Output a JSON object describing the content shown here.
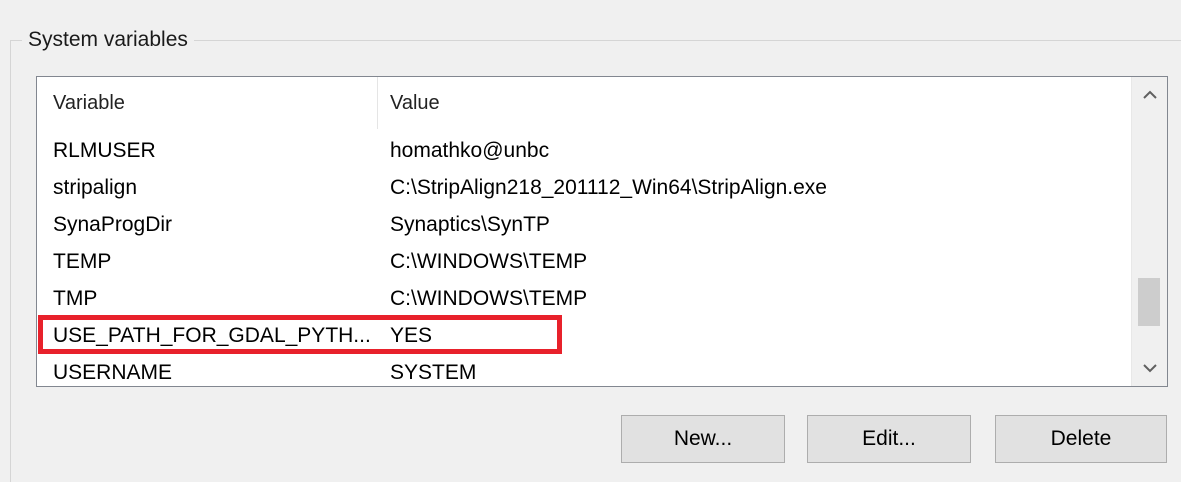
{
  "group": {
    "title": "System variables"
  },
  "list": {
    "columns": {
      "variable": "Variable",
      "value": "Value"
    },
    "rows": [
      {
        "variable": "RLMUSER",
        "value": "homathko@unbc"
      },
      {
        "variable": "stripalign",
        "value": "C:\\StripAlign218_201112_Win64\\StripAlign.exe"
      },
      {
        "variable": "SynaProgDir",
        "value": "Synaptics\\SynTP"
      },
      {
        "variable": "TEMP",
        "value": "C:\\WINDOWS\\TEMP"
      },
      {
        "variable": "TMP",
        "value": "C:\\WINDOWS\\TEMP"
      },
      {
        "variable": "USE_PATH_FOR_GDAL_PYTH...",
        "value": "YES"
      },
      {
        "variable": "USERNAME",
        "value": "SYSTEM"
      }
    ],
    "highlight_color": "#e8212b",
    "scroll": {
      "up_icon": "chevron-up-icon",
      "down_icon": "chevron-down-icon"
    }
  },
  "buttons": {
    "new_label": "New...",
    "edit_label": "Edit...",
    "delete_label": "Delete"
  }
}
